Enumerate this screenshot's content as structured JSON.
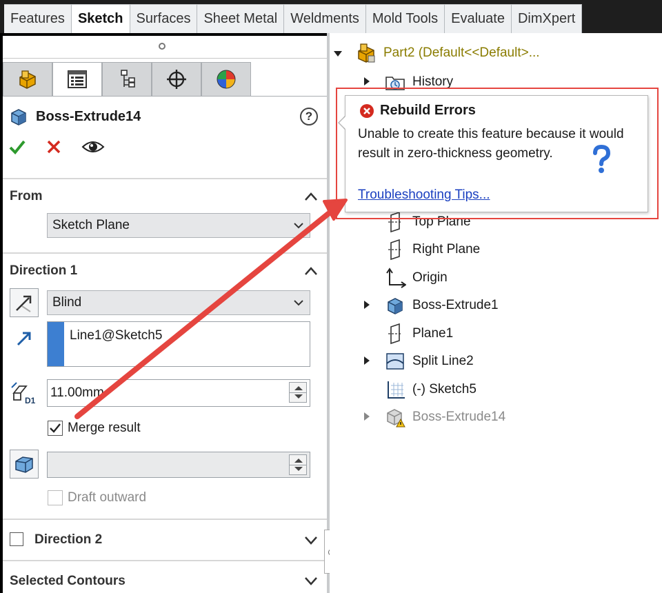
{
  "tabs": [
    "Features",
    "Sketch",
    "Surfaces",
    "Sheet Metal",
    "Weldments",
    "Mold Tools",
    "Evaluate",
    "DimXpert"
  ],
  "active_tab": "Sketch",
  "property_manager": {
    "feature_title": "Boss-Extrude14",
    "help_symbol": "?",
    "panel_tabs": [
      "feature-manager-icon",
      "property-manager-icon",
      "configuration-manager-icon",
      "dimxpert-manager-icon",
      "display-manager-icon"
    ],
    "from": {
      "title": "From",
      "value": "Sketch Plane"
    },
    "direction1": {
      "title": "Direction 1",
      "end_condition": "Blind",
      "direction_ref": "Line1@Sketch5",
      "depth": "11.00mm",
      "depth_icon_text": "D1",
      "merge_result_label": "Merge result",
      "merge_result_checked": true,
      "draft_outward_label": "Draft outward",
      "draft_value": ""
    },
    "direction2": {
      "title": "Direction 2"
    },
    "selected_contours": {
      "title": "Selected Contours"
    }
  },
  "tree": {
    "root": "Part2  (Default<<Default>...",
    "items": [
      {
        "label": "History",
        "icon": "history-folder-icon"
      },
      {
        "label": "Top Plane",
        "icon": "plane-icon"
      },
      {
        "label": "Right Plane",
        "icon": "plane-icon"
      },
      {
        "label": "Origin",
        "icon": "origin-icon"
      },
      {
        "label": "Boss-Extrude1",
        "icon": "extrude-icon"
      },
      {
        "label": "Plane1",
        "icon": "plane-icon"
      },
      {
        "label": "Split Line2",
        "icon": "split-line-icon"
      },
      {
        "label": "(-) Sketch5",
        "icon": "sketch-icon"
      },
      {
        "label": "Boss-Extrude14",
        "icon": "extrude-warning-icon"
      }
    ]
  },
  "tooltip": {
    "title": "Rebuild Errors",
    "message": "Unable to create this feature because it would result in zero-thickness geometry.",
    "link": "Troubleshooting Tips..."
  },
  "colors": {
    "annotation_red": "#e5453f",
    "link_blue": "#1a3fc0",
    "ok_green": "#2e9a2e",
    "cancel_red": "#d42a1f",
    "selection_blue": "#3d7fd1"
  }
}
